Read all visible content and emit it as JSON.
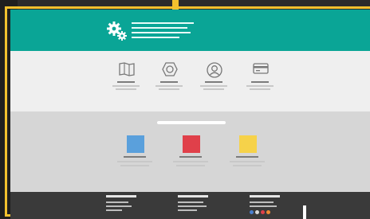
{
  "colors": {
    "frame": "#f2c12e",
    "header": "#0aa596",
    "features_bg": "#efefef",
    "showcase_bg": "#d6d6d6",
    "footer_bg": "#3a3a3a",
    "tile_blue": "#5aa0dc",
    "tile_red": "#e0404a",
    "tile_yellow": "#f6d24a",
    "dot_blue": "#4a7fd0",
    "dot_white": "#d8d8d8",
    "dot_red": "#e0404a",
    "dot_orange": "#f08a32"
  },
  "icons": {
    "logo": "gears-icon",
    "feature_1": "map-icon",
    "feature_2": "hex-nut-icon",
    "feature_3": "user-icon",
    "feature_4": "credit-card-icon"
  }
}
